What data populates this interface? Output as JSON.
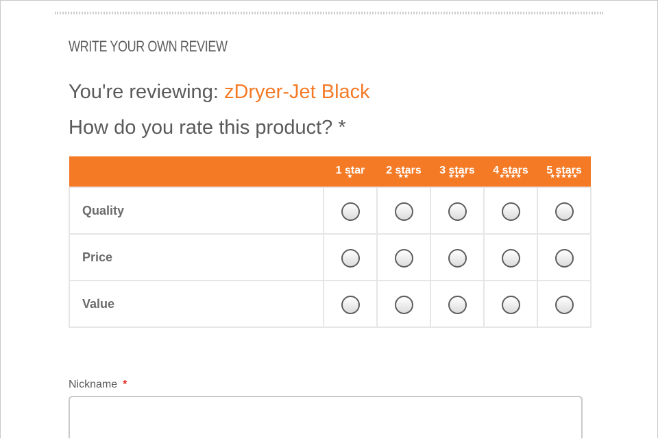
{
  "review": {
    "section_title": "WRITE YOUR OWN REVIEW",
    "reviewing_prefix": "You're reviewing:",
    "product_name": "zDryer-Jet Black",
    "rate_question": "How do you rate this product? *"
  },
  "rating_table": {
    "columns": [
      "1 star",
      "2 stars",
      "3 stars",
      "4 stars",
      "5 stars"
    ],
    "column_star_glyphs": [
      "★",
      "★★",
      "★★★",
      "★★★★",
      "★★★★★"
    ],
    "rows": [
      "Quality",
      "Price",
      "Value"
    ],
    "selected": {
      "Quality": null,
      "Price": null,
      "Value": null
    }
  },
  "nickname": {
    "label": "Nickname",
    "required_mark": "*",
    "value": "",
    "placeholder": ""
  },
  "colors": {
    "accent": "#f47a26",
    "text": "#5a5a5a",
    "required": "#e02b27",
    "table_border": "#e6e6e6"
  }
}
